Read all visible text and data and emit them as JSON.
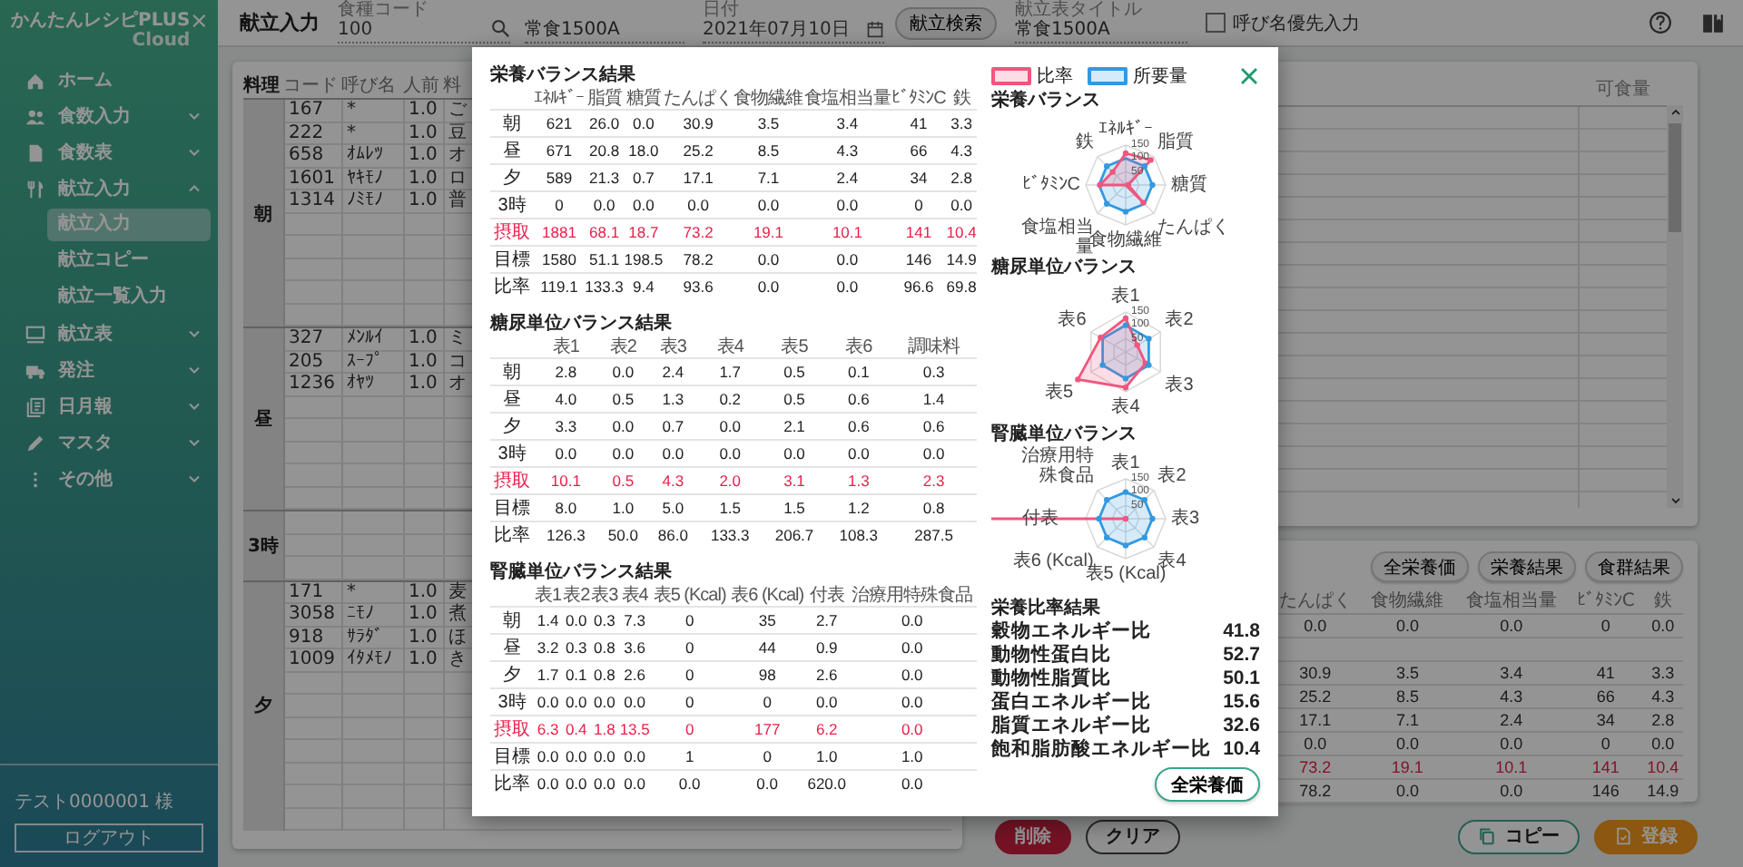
{
  "sidebar": {
    "logo": "かんたんレシピPLUS",
    "logo_sub": "Cloud",
    "menu": [
      {
        "label": "ホーム"
      },
      {
        "label": "食数入力",
        "expanded": false
      },
      {
        "label": "食数表",
        "expanded": false
      },
      {
        "label": "献立入力",
        "expanded": true,
        "children": [
          {
            "label": "献立入力",
            "selected": true
          },
          {
            "label": "献立コピー",
            "selected": false
          },
          {
            "label": "献立一覧入力",
            "selected": false
          }
        ]
      },
      {
        "label": "献立表",
        "expanded": false
      },
      {
        "label": "発注",
        "expanded": false
      },
      {
        "label": "日月報",
        "expanded": false
      },
      {
        "label": "マスタ",
        "expanded": false
      },
      {
        "label": "その他",
        "expanded": false
      }
    ],
    "user": "テスト0000001 様",
    "logout": "ログアウト"
  },
  "header": {
    "title": "献立入力",
    "controls": [
      {
        "kind": "search",
        "label": "食種コード",
        "value": "100"
      },
      {
        "kind": "text",
        "value": "常食1500A"
      },
      {
        "kind": "date",
        "label": "日付",
        "value": "2021年07月10日"
      },
      {
        "kind": "button",
        "label": "献立検索"
      },
      {
        "kind": "text",
        "label": "献立表タイトル",
        "value": "常食1500A"
      },
      {
        "kind": "checkbox",
        "label": "呼び名優先入力",
        "checked": false
      }
    ]
  },
  "menu_table": {
    "columns": [
      "料理",
      "コード",
      "呼び名",
      "人前",
      "料"
    ],
    "sections": [
      {
        "label": "朝",
        "rows": [
          {
            "cells": [
              "167",
              "*",
              "1.0",
              "ご"
            ]
          },
          {
            "cells": [
              "222",
              "*",
              "1.0",
              "豆"
            ]
          },
          {
            "cells": [
              "658",
              "ｵﾑﾚﾂ",
              "1.0",
              "オ"
            ]
          },
          {
            "cells": [
              "1601",
              "ﾔｷﾓﾉ",
              "1.0",
              "ロ"
            ]
          },
          {
            "cells": [
              "1314",
              "ﾉﾐﾓﾉ",
              "1.0",
              "普"
            ]
          }
        ]
      },
      {
        "label": "昼",
        "rows": [
          {
            "cells": [
              "327",
              "ﾒﾝﾙｲ",
              "1.0",
              "ミ"
            ]
          },
          {
            "cells": [
              "205",
              "ｽｰﾌﾟ",
              "1.0",
              "コ"
            ]
          },
          {
            "cells": [
              "1236",
              "ｵﾔﾂ",
              "1.0",
              "オ"
            ]
          }
        ]
      },
      {
        "label": "3時"
      },
      {
        "label": "夕",
        "rows": [
          {
            "cells": [
              "171",
              "*",
              "1.0",
              "麦"
            ]
          },
          {
            "cells": [
              "3058",
              "ﾆﾓﾉ",
              "1.0",
              "煮"
            ]
          },
          {
            "cells": [
              "918",
              "ｻﾗﾀﾞ",
              "1.0",
              "ほ"
            ]
          },
          {
            "cells": [
              "1009",
              "ｲﾀﾒﾓﾉ",
              "1.0",
              "き"
            ]
          }
        ]
      }
    ]
  },
  "ingredient_table": {
    "columns": [
      "可食量"
    ]
  },
  "nutrition_summary": {
    "buttons": [
      "全栄養価",
      "栄養結果",
      "食群結果"
    ],
    "columns": [
      "たんぱく",
      "食物繊維",
      "食塩相当量",
      "ﾋﾞﾀﾐﾝC",
      "鉄"
    ],
    "rows": [
      {
        "kind": "data",
        "cells": [
          "0.0",
          "0.0",
          "0.0",
          "0",
          "0.0"
        ]
      },
      {
        "kind": "spacer"
      },
      {
        "kind": "data",
        "cells": [
          "30.9",
          "3.5",
          "3.4",
          "41",
          "3.3"
        ]
      },
      {
        "kind": "data",
        "cells": [
          "25.2",
          "8.5",
          "4.3",
          "66",
          "4.3"
        ]
      },
      {
        "kind": "data",
        "cells": [
          "17.1",
          "7.1",
          "2.4",
          "34",
          "2.8"
        ]
      },
      {
        "kind": "data",
        "cells": [
          "0.0",
          "0.0",
          "0.0",
          "0",
          "0.0"
        ]
      },
      {
        "kind": "total",
        "cells": [
          "73.2",
          "19.1",
          "10.1",
          "141",
          "10.4"
        ]
      },
      {
        "kind": "data",
        "cells": [
          "78.2",
          "0.0",
          "0.0",
          "146",
          "14.9"
        ]
      }
    ]
  },
  "actions": [
    {
      "kind": "delete",
      "label": "削除"
    },
    {
      "kind": "clear",
      "label": "クリア"
    },
    {
      "kind": "copy",
      "label": "コピー"
    },
    {
      "kind": "register",
      "label": "登録"
    }
  ],
  "modal": {
    "tables": [
      {
        "title": "栄養バランス結果",
        "columns": [
          "ｴﾈﾙｷﾞｰ",
          "脂質",
          "糖質",
          "たんぱく",
          "食物繊維",
          "食塩相当量",
          "ﾋﾞﾀﾐﾝC",
          "鉄"
        ],
        "rows": [
          {
            "label": "朝",
            "kind": "data",
            "cells": [
              "621",
              "26.0",
              "0.0",
              "30.9",
              "3.5",
              "3.4",
              "41",
              "3.3"
            ]
          },
          {
            "label": "昼",
            "kind": "data",
            "cells": [
              "671",
              "20.8",
              "18.0",
              "25.2",
              "8.5",
              "4.3",
              "66",
              "4.3"
            ]
          },
          {
            "label": "夕",
            "kind": "data",
            "cells": [
              "589",
              "21.3",
              "0.7",
              "17.1",
              "7.1",
              "2.4",
              "34",
              "2.8"
            ]
          },
          {
            "label": "3時",
            "kind": "data",
            "cells": [
              "0",
              "0.0",
              "0.0",
              "0.0",
              "0.0",
              "0.0",
              "0",
              "0.0"
            ]
          },
          {
            "label": "摂取",
            "kind": "total",
            "cells": [
              "1881",
              "68.1",
              "18.7",
              "73.2",
              "19.1",
              "10.1",
              "141",
              "10.4"
            ]
          },
          {
            "label": "目標",
            "kind": "data",
            "cells": [
              "1580",
              "51.1",
              "198.5",
              "78.2",
              "0.0",
              "0.0",
              "146",
              "14.9"
            ]
          },
          {
            "label": "比率",
            "kind": "data",
            "cells": [
              "119.1",
              "133.3",
              "9.4",
              "93.6",
              "0.0",
              "0.0",
              "96.6",
              "69.8"
            ]
          }
        ]
      },
      {
        "title": "糖尿単位バランス結果",
        "columns": [
          "表1",
          "表2",
          "表3",
          "表4",
          "表5",
          "表6",
          "調味料"
        ],
        "rows": [
          {
            "label": "朝",
            "kind": "data",
            "cells": [
              "2.8",
              "0.0",
              "2.4",
              "1.7",
              "0.5",
              "0.1",
              "0.3"
            ]
          },
          {
            "label": "昼",
            "kind": "data",
            "cells": [
              "4.0",
              "0.5",
              "1.3",
              "0.2",
              "0.5",
              "0.6",
              "1.4"
            ]
          },
          {
            "label": "夕",
            "kind": "data",
            "cells": [
              "3.3",
              "0.0",
              "0.7",
              "0.0",
              "2.1",
              "0.6",
              "0.6"
            ]
          },
          {
            "label": "3時",
            "kind": "data",
            "cells": [
              "0.0",
              "0.0",
              "0.0",
              "0.0",
              "0.0",
              "0.0",
              "0.0"
            ]
          },
          {
            "label": "摂取",
            "kind": "total",
            "cells": [
              "10.1",
              "0.5",
              "4.3",
              "2.0",
              "3.1",
              "1.3",
              "2.3"
            ]
          },
          {
            "label": "目標",
            "kind": "data",
            "cells": [
              "8.0",
              "1.0",
              "5.0",
              "1.5",
              "1.5",
              "1.2",
              "0.8"
            ]
          },
          {
            "label": "比率",
            "kind": "data",
            "cells": [
              "126.3",
              "50.0",
              "86.0",
              "133.3",
              "206.7",
              "108.3",
              "287.5"
            ]
          }
        ]
      },
      {
        "title": "腎臓単位バランス結果",
        "columns": [
          "表1",
          "表2",
          "表3",
          "表4",
          "表5 (Kcal)",
          "表6 (Kcal)",
          "付表",
          "治療用特殊食品"
        ],
        "rows": [
          {
            "label": "朝",
            "kind": "data",
            "cells": [
              "1.4",
              "0.0",
              "0.3",
              "7.3",
              "0",
              "35",
              "2.7",
              "0.0"
            ]
          },
          {
            "label": "昼",
            "kind": "data",
            "cells": [
              "3.2",
              "0.3",
              "0.8",
              "3.6",
              "0",
              "44",
              "0.9",
              "0.0"
            ]
          },
          {
            "label": "夕",
            "kind": "data",
            "cells": [
              "1.7",
              "0.1",
              "0.8",
              "2.6",
              "0",
              "98",
              "2.6",
              "0.0"
            ]
          },
          {
            "label": "3時",
            "kind": "data",
            "cells": [
              "0.0",
              "0.0",
              "0.0",
              "0.0",
              "0",
              "0",
              "0.0",
              "0.0"
            ]
          },
          {
            "label": "摂取",
            "kind": "total",
            "cells": [
              "6.3",
              "0.4",
              "1.8",
              "13.5",
              "0",
              "177",
              "6.2",
              "0.0"
            ]
          },
          {
            "label": "目標",
            "kind": "data",
            "cells": [
              "0.0",
              "0.0",
              "0.0",
              "0.0",
              "1",
              "0",
              "1.0",
              "1.0"
            ]
          },
          {
            "label": "比率",
            "kind": "data",
            "cells": [
              "0.0",
              "0.0",
              "0.0",
              "0.0",
              "0.0",
              "0.0",
              "620.0",
              "0.0"
            ]
          }
        ]
      }
    ],
    "legend": [
      {
        "label": "比率",
        "color": "#f0567e"
      },
      {
        "label": "所要量",
        "color": "#3399e0"
      }
    ],
    "charts": [
      {
        "title": "栄養バランス",
        "axes": [
          "ｴﾈﾙｷﾞｰ",
          "鉄",
          "脂質",
          "ﾋﾞﾀﾐﾝC",
          "糖質",
          "食塩相当量",
          "たんぱく",
          "食物繊維"
        ],
        "ticks": [
          "150",
          "100",
          "50"
        ]
      },
      {
        "title": "糖尿単位バランス",
        "axes": [
          "表1",
          "表2",
          "表3",
          "表4",
          "表5",
          "表6"
        ],
        "ticks": [
          "150",
          "100",
          "50"
        ]
      },
      {
        "title": "腎臓単位バランス",
        "axes": [
          "表1",
          "治療用特殊食品",
          "表2",
          "付表",
          "表3",
          "表6 (Kcal)",
          "表4",
          "表5 (Kcal)"
        ],
        "ticks": [
          "150",
          "100",
          "50"
        ]
      }
    ],
    "ratios_title": "栄養比率結果",
    "ratios": [
      {
        "label": "穀物エネルギー比",
        "value": "41.8"
      },
      {
        "label": "動物性蛋白比",
        "value": "52.7"
      },
      {
        "label": "動物性脂質比",
        "value": "50.1"
      },
      {
        "label": "蛋白エネルギー比",
        "value": "15.6"
      },
      {
        "label": "脂質エネルギー比",
        "value": "32.6"
      },
      {
        "label": "飽和脂肪酸エネルギー比",
        "value": "10.4"
      }
    ],
    "button": "全栄養価"
  }
}
